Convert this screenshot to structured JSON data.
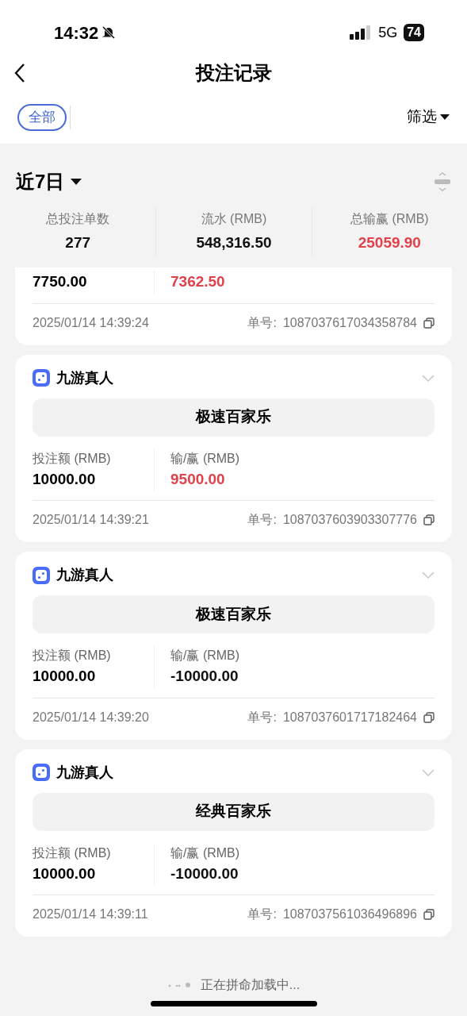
{
  "status_bar": {
    "time": "14:32",
    "network": "5G",
    "battery": "74"
  },
  "header": {
    "title": "投注记录"
  },
  "filters": {
    "chips": [
      {
        "label": "全部",
        "selected": true
      }
    ],
    "filter_button": "筛选"
  },
  "summary": {
    "period": "近7日",
    "stats": [
      {
        "label": "总投注单数",
        "value": "277",
        "color": "#111111"
      },
      {
        "label": "流水 (RMB)",
        "value": "548,316.50",
        "color": "#111111"
      },
      {
        "label": "总输赢 (RMB)",
        "value": "25059.90",
        "color": "#e0414b"
      }
    ]
  },
  "partial_record": {
    "stake": "7750.00",
    "result": "7362.50",
    "color": "#e0414b",
    "time": "2025/01/14 14:39:24",
    "order_label": "单号:",
    "order_no": "1087037617034358784"
  },
  "records": [
    {
      "provider": "九游真人",
      "game": "极速百家乐",
      "stake_label": "投注额 (RMB)",
      "stake": "10000.00",
      "result_label": "输/赢 (RMB)",
      "result": "9500.00",
      "color": "#e0414b",
      "time": "2025/01/14 14:39:21",
      "order_label": "单号:",
      "order_no": "1087037603903307776"
    },
    {
      "provider": "九游真人",
      "game": "极速百家乐",
      "stake_label": "投注额 (RMB)",
      "stake": "10000.00",
      "result_label": "输/赢 (RMB)",
      "result": "-10000.00",
      "color": "#111111",
      "time": "2025/01/14 14:39:20",
      "order_label": "单号:",
      "order_no": "1087037601717182464"
    },
    {
      "provider": "九游真人",
      "game": "经典百家乐",
      "stake_label": "投注额 (RMB)",
      "stake": "10000.00",
      "result_label": "输/赢 (RMB)",
      "result": "-10000.00",
      "color": "#111111",
      "time": "2025/01/14 14:39:11",
      "order_label": "单号:",
      "order_no": "1087037561036496896"
    }
  ],
  "loading": {
    "text": "正在拼命加载中..."
  }
}
